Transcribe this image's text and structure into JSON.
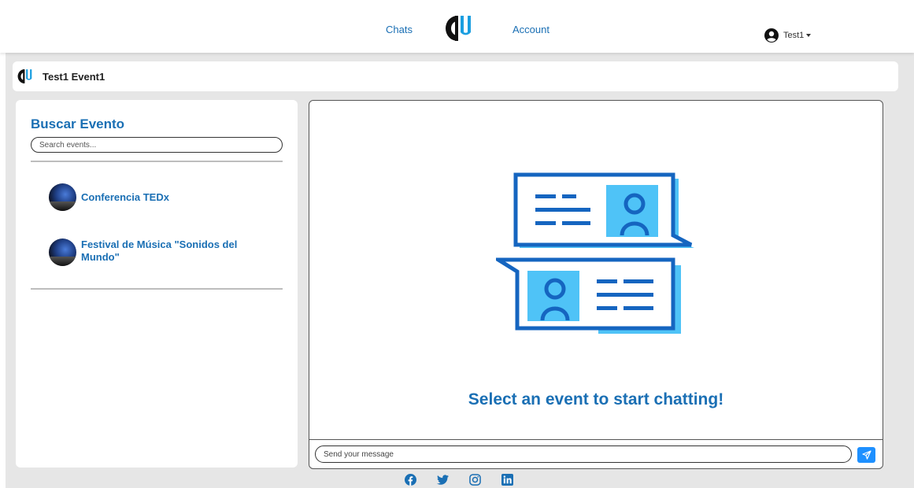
{
  "navbar": {
    "chats_label": "Chats",
    "account_label": "Account",
    "logo_icon": "cu-logo-icon",
    "user_icon": "user-circle-icon",
    "user_name": "Test1"
  },
  "title_bar": {
    "title": "Test1 Event1"
  },
  "events_panel": {
    "heading": "Buscar Evento",
    "search_placeholder": "Search events...",
    "events": [
      {
        "name": "Conferencia TEDx"
      },
      {
        "name": "Festival de Música \"Sonidos del Mundo\""
      }
    ]
  },
  "chat": {
    "empty_state_text": "Select an event to start chatting!",
    "message_placeholder": "Send your message",
    "send_icon": "paper-plane-icon"
  },
  "footer": {
    "social": [
      "facebook-icon",
      "twitter-icon",
      "instagram-icon",
      "linkedin-icon"
    ]
  },
  "colors": {
    "brand_blue": "#1a6fb4",
    "accent_cyan": "#4fc3f7",
    "send_button": "#1e90ff",
    "background_gray": "#e6e6e6"
  }
}
